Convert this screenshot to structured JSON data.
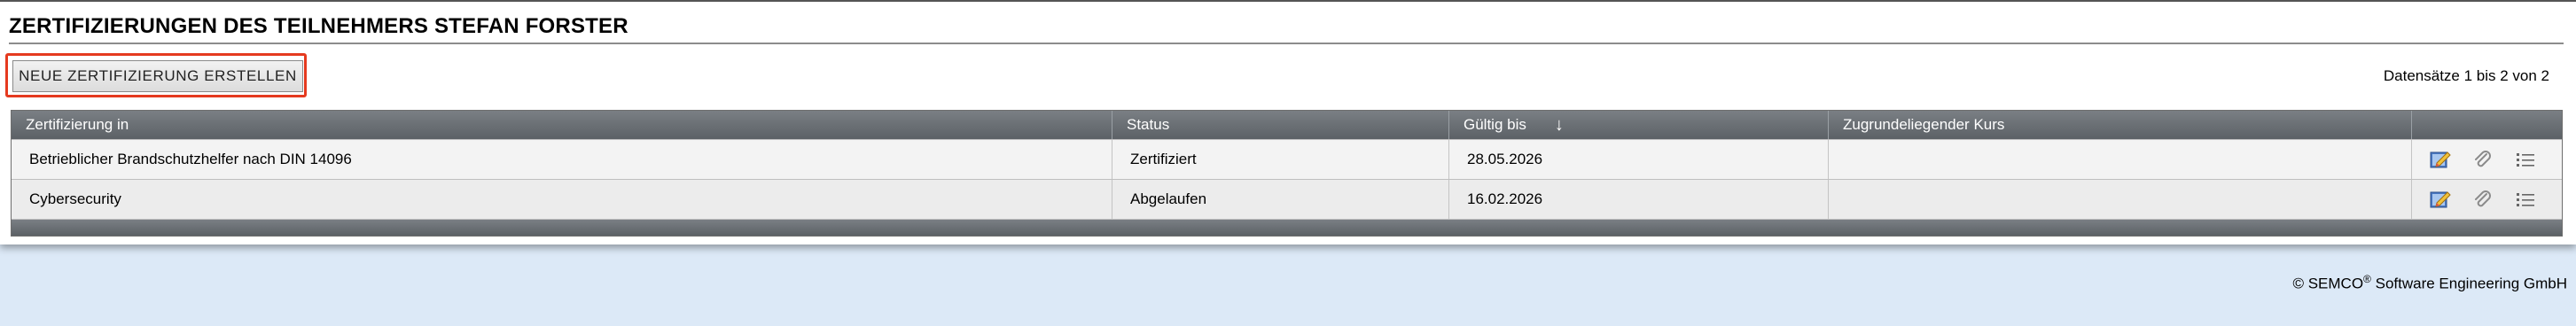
{
  "page": {
    "title": "ZERTIFIZIERUNGEN DES TEILNEHMERS STEFAN FORSTER",
    "new_button_label": "NEUE ZERTIFIZIERUNG ERSTELLEN",
    "records_info": "Datensätze 1 bis 2 von 2"
  },
  "table": {
    "columns": [
      "Zertifizierung in",
      "Status",
      "Gültig bis",
      "Zugrundeliegender Kurs",
      ""
    ],
    "sort_indicator": "↓",
    "rows": [
      {
        "certification": "Betrieblicher Brandschutzhelfer nach DIN 14096",
        "status": "Zertifiziert",
        "valid_until": "28.05.2026",
        "course": ""
      },
      {
        "certification": "Cybersecurity",
        "status": "Abgelaufen",
        "valid_until": "16.02.2026",
        "course": ""
      }
    ]
  },
  "icons": {
    "edit": "edit-icon",
    "attach": "paperclip-icon",
    "list": "list-icon"
  },
  "colors": {
    "highlight": "#e53a1f",
    "header_bg": "#5c6166",
    "page_bg": "#dce9f7"
  },
  "footer": {
    "copyright_prefix": "© SEMCO",
    "registered": "®",
    "copyright_suffix": " Software Engineering GmbH"
  }
}
